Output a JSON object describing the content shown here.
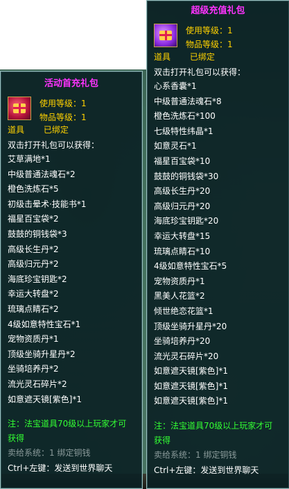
{
  "left_tooltip": {
    "title": "活动首充礼包",
    "use_level": "使用等级：1",
    "item_level": "物品等级：1",
    "tag_type": "道具",
    "tag_bound": "已绑定",
    "desc_title": "双击打开礼包可以获得：",
    "rewards": [
      "艾草满地*1",
      "中级普通法魂石*2",
      "橙色洗炼石*5",
      "初级击晕术·技能书*1",
      "福星百宝袋*2",
      "鼓鼓的铜钱袋*3",
      "高级长生丹*2",
      "高级归元丹*2",
      "海底珍宝钥匙*2",
      "幸运大转盘*2",
      "琉璃点睛石*2",
      "4级如意特性宝石*1",
      "宠物资质丹*1",
      "顶级坐骑升星丹*2",
      "坐骑培养丹*2",
      "流光灵石碎片*2",
      "如意遮天镜[紫色]*1"
    ],
    "note_line1": "注：法宝道具70级以上玩家才可",
    "note_line2": "获得",
    "sell": "卖给系统：1 绑定铜钱",
    "shortcut": "Ctrl+左键：发送到世界聊天"
  },
  "right_tooltip": {
    "title": "超级充值礼包",
    "use_level": "使用等级：1",
    "item_level": "物品等级：1",
    "tag_type": "道具",
    "tag_bound": "已绑定",
    "desc_title": "双击打开礼包可以获得：",
    "rewards": [
      "心系香囊*1",
      "中级普通法魂石*8",
      "橙色洗炼石*100",
      "七级特性纬晶*1",
      "如意灵石*1",
      "福星百宝袋*10",
      "鼓鼓的铜钱袋*30",
      "高级长生丹*20",
      "高级归元丹*20",
      "海底珍宝钥匙*20",
      "幸运大转盘*15",
      "琉璃点睛石*10",
      "4级如意特性宝石*5",
      "宠物资质丹*1",
      "黑美人花篮*2",
      "倾世绝恋花篮*1",
      "顶级坐骑升星丹*20",
      "坐骑培养丹*20",
      "流光灵石碎片*20",
      "如意遮天镜[紫色]*1",
      "如意遮天镜[紫色]*1",
      "如意遮天镜[紫色]*1"
    ],
    "note_line1": "注：法宝道具70级以上玩家才可",
    "note_line2": "获得",
    "sell": "卖给系统：1 绑定铜钱",
    "shortcut": "Ctrl+左键：发送到世界聊天"
  }
}
